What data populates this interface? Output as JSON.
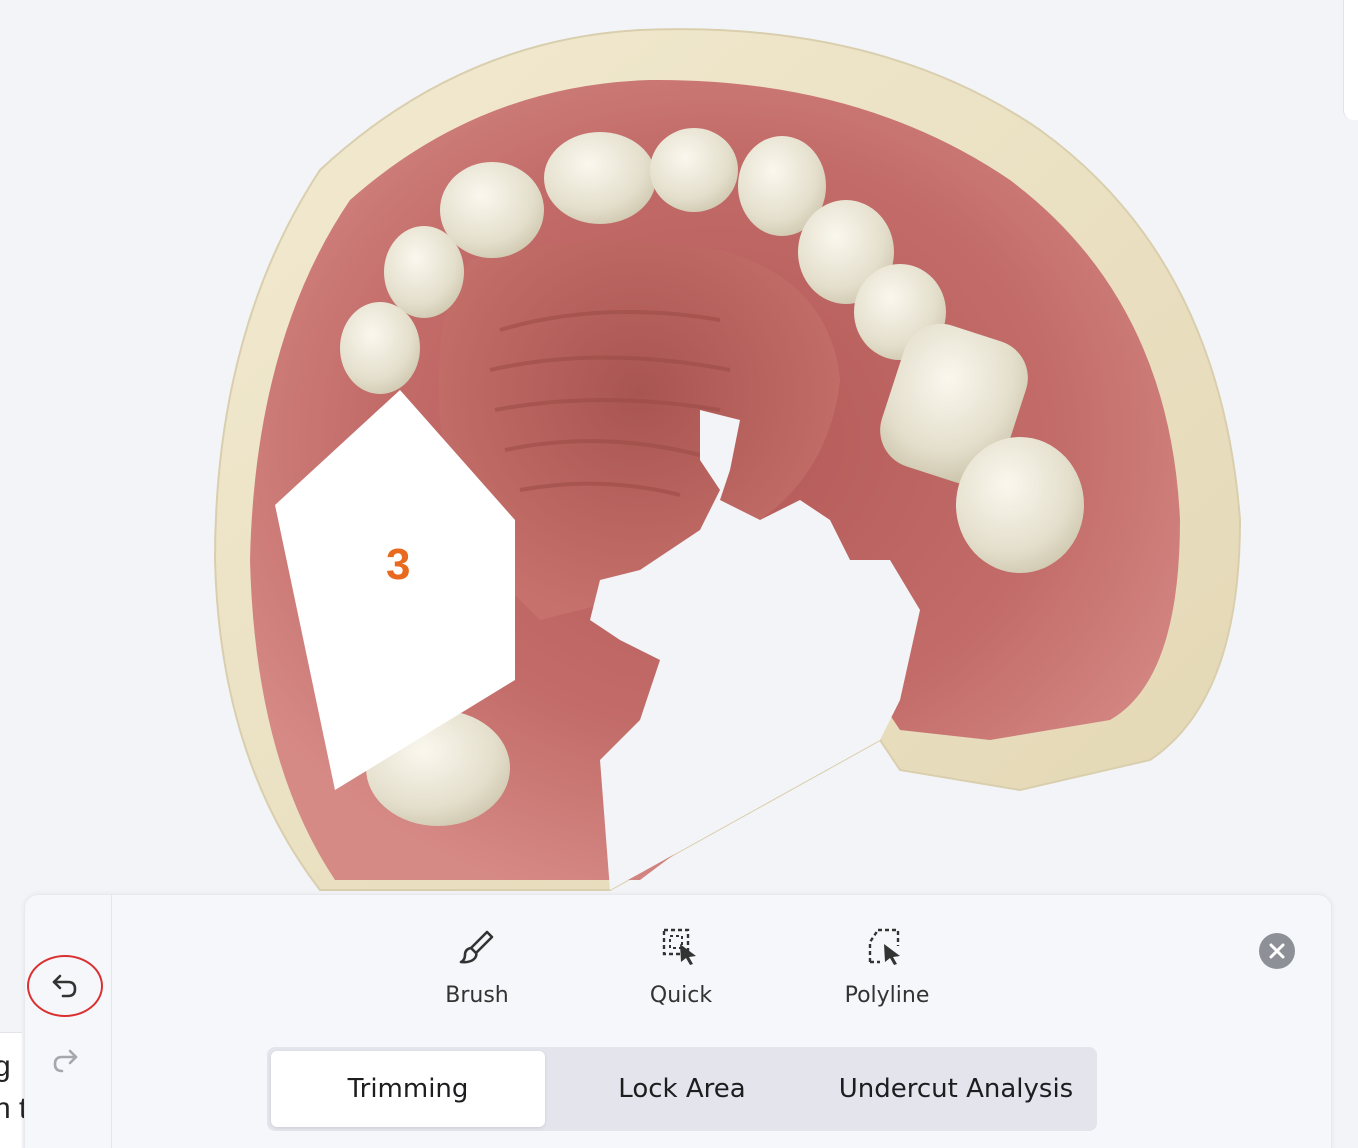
{
  "viewport": {
    "marker_number": "3",
    "left_edge_fragments": [
      "g",
      "n t"
    ]
  },
  "toolbar": {
    "history": {
      "undo_icon": "undo-arrow-icon",
      "redo_icon": "redo-arrow-icon"
    },
    "tools": [
      {
        "label": "Brush",
        "icon": "brush-icon"
      },
      {
        "label": "Quick",
        "icon": "quick-select-icon"
      },
      {
        "label": "Polyline",
        "icon": "polyline-select-icon"
      }
    ],
    "close_icon": "close-icon",
    "tabs": [
      {
        "label": "Trimming",
        "active": true
      },
      {
        "label": "Lock Area",
        "active": false
      },
      {
        "label": "Undercut Analysis",
        "active": false
      }
    ]
  },
  "colors": {
    "accent_marker": "#e86a1e",
    "undo_highlight": "#d93030",
    "gum": "#c86a6a",
    "tooth": "#e9e4d3",
    "plaster": "#ede4c8"
  }
}
